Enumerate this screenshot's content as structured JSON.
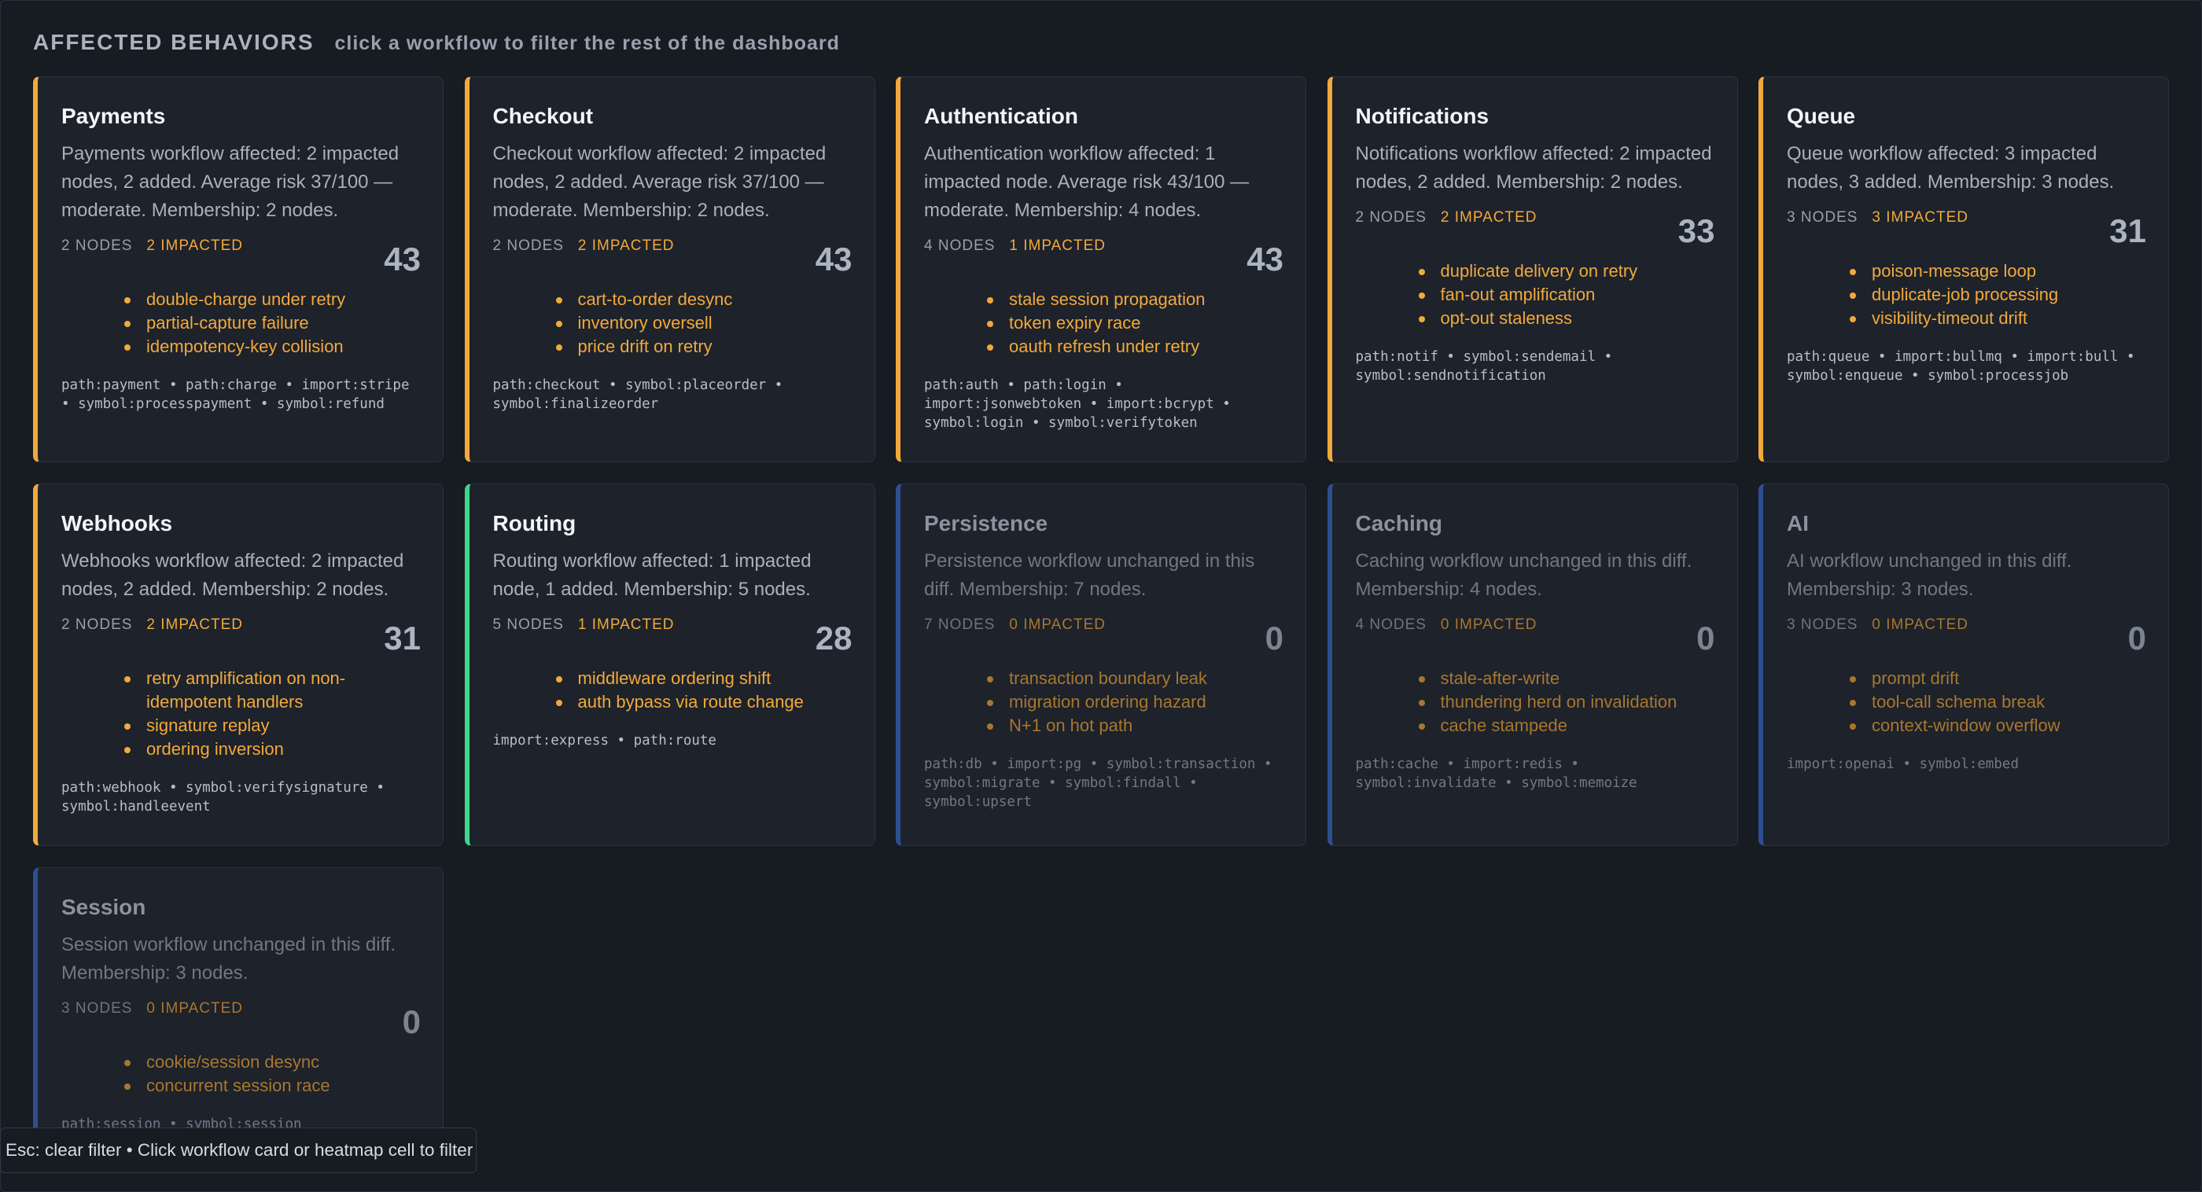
{
  "header": {
    "title": "AFFECTED BEHAVIORS",
    "subtitle": "click a workflow to filter the rest of the dashboard"
  },
  "cards": [
    {
      "title": "Payments",
      "description": "Payments workflow affected: 2 impacted nodes, 2 added. Average risk 37/100 — moderate. Membership: 2 nodes.",
      "nodes": "2 NODES",
      "impacted": "2 IMPACTED",
      "score": "43",
      "behaviors": [
        "double-charge under retry",
        "partial-capture failure",
        "idempotency-key collision"
      ],
      "tags": "path:payment • path:charge • import:stripe • symbol:processpayment • symbol:refund",
      "accent": "#f2a93b"
    },
    {
      "title": "Checkout",
      "description": "Checkout workflow affected: 2 impacted nodes, 2 added. Average risk 37/100 — moderate. Membership: 2 nodes.",
      "nodes": "2 NODES",
      "impacted": "2 IMPACTED",
      "score": "43",
      "behaviors": [
        "cart-to-order desync",
        "inventory oversell",
        "price drift on retry"
      ],
      "tags": "path:checkout • symbol:placeorder • symbol:finalizeorder",
      "accent": "#f2a93b"
    },
    {
      "title": "Authentication",
      "description": "Authentication workflow affected: 1 impacted node. Average risk 43/100 — moderate. Membership: 4 nodes.",
      "nodes": "4 NODES",
      "impacted": "1 IMPACTED",
      "score": "43",
      "behaviors": [
        "stale session propagation",
        "token expiry race",
        "oauth refresh under retry"
      ],
      "tags": "path:auth • path:login • import:jsonwebtoken • import:bcrypt • symbol:login • symbol:verifytoken",
      "accent": "#f2a93b"
    },
    {
      "title": "Notifications",
      "description": "Notifications workflow affected: 2 impacted nodes, 2 added. Membership: 2 nodes.",
      "nodes": "2 NODES",
      "impacted": "2 IMPACTED",
      "score": "33",
      "behaviors": [
        "duplicate delivery on retry",
        "fan-out amplification",
        "opt-out staleness"
      ],
      "tags": "path:notif • symbol:sendemail • symbol:sendnotification",
      "accent": "#f2a93b"
    },
    {
      "title": "Queue",
      "description": "Queue workflow affected: 3 impacted nodes, 3 added. Membership: 3 nodes.",
      "nodes": "3 NODES",
      "impacted": "3 IMPACTED",
      "score": "31",
      "behaviors": [
        "poison-message loop",
        "duplicate-job processing",
        "visibility-timeout drift"
      ],
      "tags": "path:queue • import:bullmq • import:bull • symbol:enqueue • symbol:processjob",
      "accent": "#f2a93b"
    },
    {
      "title": "Webhooks",
      "description": "Webhooks workflow affected: 2 impacted nodes, 2 added. Membership: 2 nodes.",
      "nodes": "2 NODES",
      "impacted": "2 IMPACTED",
      "score": "31",
      "behaviors": [
        "retry amplification on non-idempotent handlers",
        "signature replay",
        "ordering inversion"
      ],
      "tags": "path:webhook • symbol:verifysignature • symbol:handleevent",
      "accent": "#f2a93b"
    },
    {
      "title": "Routing",
      "description": "Routing workflow affected: 1 impacted node, 1 added. Membership: 5 nodes.",
      "nodes": "5 NODES",
      "impacted": "1 IMPACTED",
      "score": "28",
      "behaviors": [
        "middleware ordering shift",
        "auth bypass via route change"
      ],
      "tags": "import:express • path:route",
      "accent": "#3dd68c"
    },
    {
      "title": "Persistence",
      "description": "Persistence workflow unchanged in this diff. Membership: 7 nodes.",
      "nodes": "7 NODES",
      "impacted": "0 IMPACTED",
      "score": "0",
      "behaviors": [
        "transaction boundary leak",
        "migration ordering hazard",
        "N+1 on hot path"
      ],
      "tags": "path:db • import:pg • symbol:transaction • symbol:migrate • symbol:findall • symbol:upsert",
      "accent": "#2d4f8f"
    },
    {
      "title": "Caching",
      "description": "Caching workflow unchanged in this diff. Membership: 4 nodes.",
      "nodes": "4 NODES",
      "impacted": "0 IMPACTED",
      "score": "0",
      "behaviors": [
        "stale-after-write",
        "thundering herd on invalidation",
        "cache stampede"
      ],
      "tags": "path:cache • import:redis • symbol:invalidate • symbol:memoize",
      "accent": "#2d4f8f"
    },
    {
      "title": "AI",
      "description": "AI workflow unchanged in this diff. Membership: 3 nodes.",
      "nodes": "3 NODES",
      "impacted": "0 IMPACTED",
      "score": "0",
      "behaviors": [
        "prompt drift",
        "tool-call schema break",
        "context-window overflow"
      ],
      "tags": "import:openai • symbol:embed",
      "accent": "#2d4f8f"
    },
    {
      "title": "Session",
      "description": "Session workflow unchanged in this diff. Membership: 3 nodes.",
      "nodes": "3 NODES",
      "impacted": "0 IMPACTED",
      "score": "0",
      "behaviors": [
        "cookie/session desync",
        "concurrent session race"
      ],
      "tags": "path:session • symbol:session",
      "accent": "#2d4f8f"
    }
  ],
  "footer_hint": "Esc: clear filter • Click workflow card or heatmap cell to filter"
}
